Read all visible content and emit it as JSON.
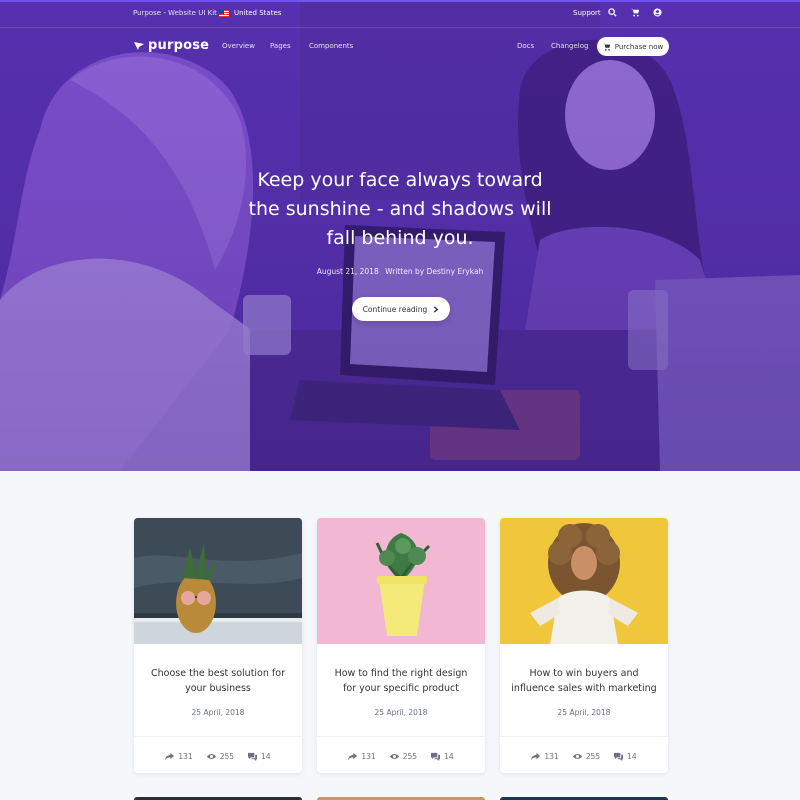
{
  "topbar": {
    "brand": "Purpose - Website UI Kit",
    "country": "United States",
    "support": "Support"
  },
  "navbar": {
    "logo": "purpose",
    "links": [
      "Overview",
      "Pages",
      "Components"
    ],
    "right_links": [
      "Docs",
      "Changelog"
    ],
    "purchase": "Purchase now"
  },
  "hero": {
    "title": "Keep your face always toward the sunshine - and shadows will fall behind you.",
    "date": "August 21, 2018",
    "author": "Written by Destiny Erykah",
    "cta": "Continue reading"
  },
  "cards": [
    {
      "title": "Choose the best solution for your business",
      "date": "25 April, 2018",
      "shares": "131",
      "views": "255",
      "comments": "14"
    },
    {
      "title": "How to find the right design for your specific product",
      "date": "25 April, 2018",
      "shares": "131",
      "views": "255",
      "comments": "14"
    },
    {
      "title": "How to win buyers and influence sales with marketing",
      "date": "25 April, 2018",
      "shares": "131",
      "views": "255",
      "comments": "14"
    }
  ],
  "colors": {
    "hero_overlay": "#5a31b0",
    "accent": "#7b5cff",
    "card_bg": "#ffffff",
    "page_bg": "#f5f7fb"
  },
  "icons": {
    "search": "search-icon",
    "cart": "cart-icon",
    "user": "user-icon",
    "share": "share-icon",
    "views": "eye-icon",
    "comments": "comments-icon"
  }
}
